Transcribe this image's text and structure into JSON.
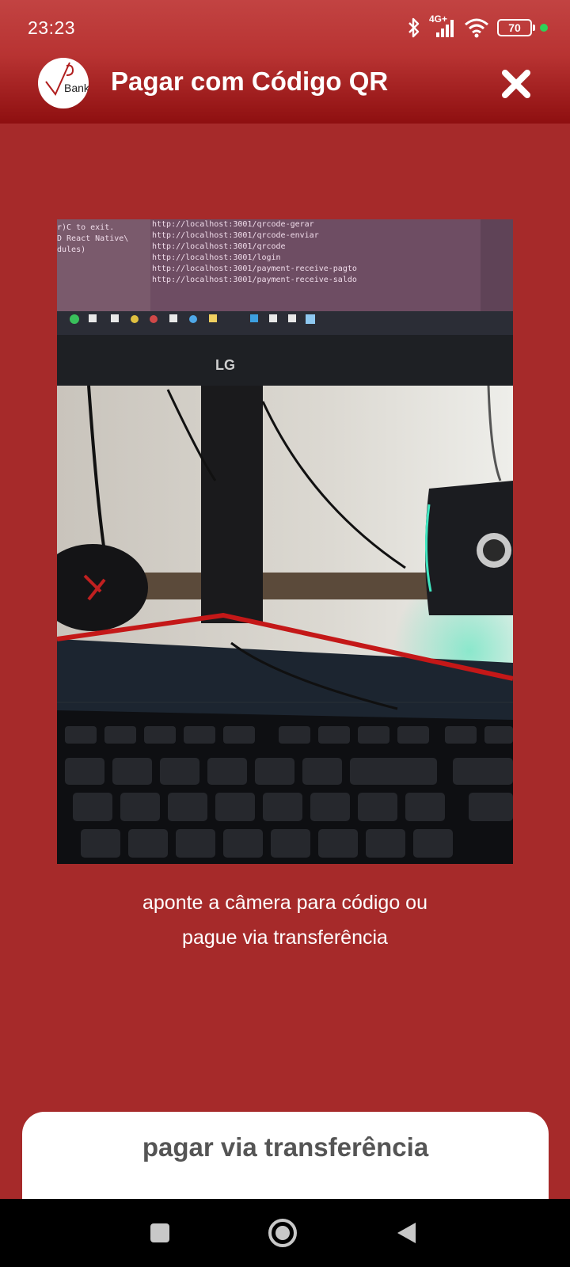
{
  "status_bar": {
    "time": "23:23",
    "network": "4G+",
    "battery": "70",
    "icons": [
      "bluetooth-icon",
      "signal-icon",
      "wifi-icon",
      "battery-icon",
      "green-dot-indicator"
    ]
  },
  "header": {
    "logo_text": "Bank",
    "title": "Pagar com Código QR",
    "close_icon": "close-icon"
  },
  "camera": {
    "monitor_brand": "LG",
    "terminal_lines": [
      "http://localhost:3001/qrcode-gerar",
      "http://localhost:3001/qrcode-enviar",
      "http://localhost:3001/qrcode",
      "http://localhost:3001/login",
      "http://localhost:3001/payment-receive-pagto",
      "http://localhost:3001/payment-receive-saldo"
    ],
    "terminal_left_lines": [
      "r)C to exit.",
      "D React Native\\",
      "dules)"
    ]
  },
  "instruction": {
    "line1": "aponte a câmera para código ou",
    "line2": "pague via transferência"
  },
  "transfer_button": {
    "label": "pagar via transferência"
  },
  "nav_bar": {
    "buttons": [
      "recents-icon",
      "home-icon",
      "back-icon"
    ]
  },
  "colors": {
    "background": "#a62a2a",
    "header_dark": "#8e0f10",
    "accent_green": "#2fd158"
  }
}
